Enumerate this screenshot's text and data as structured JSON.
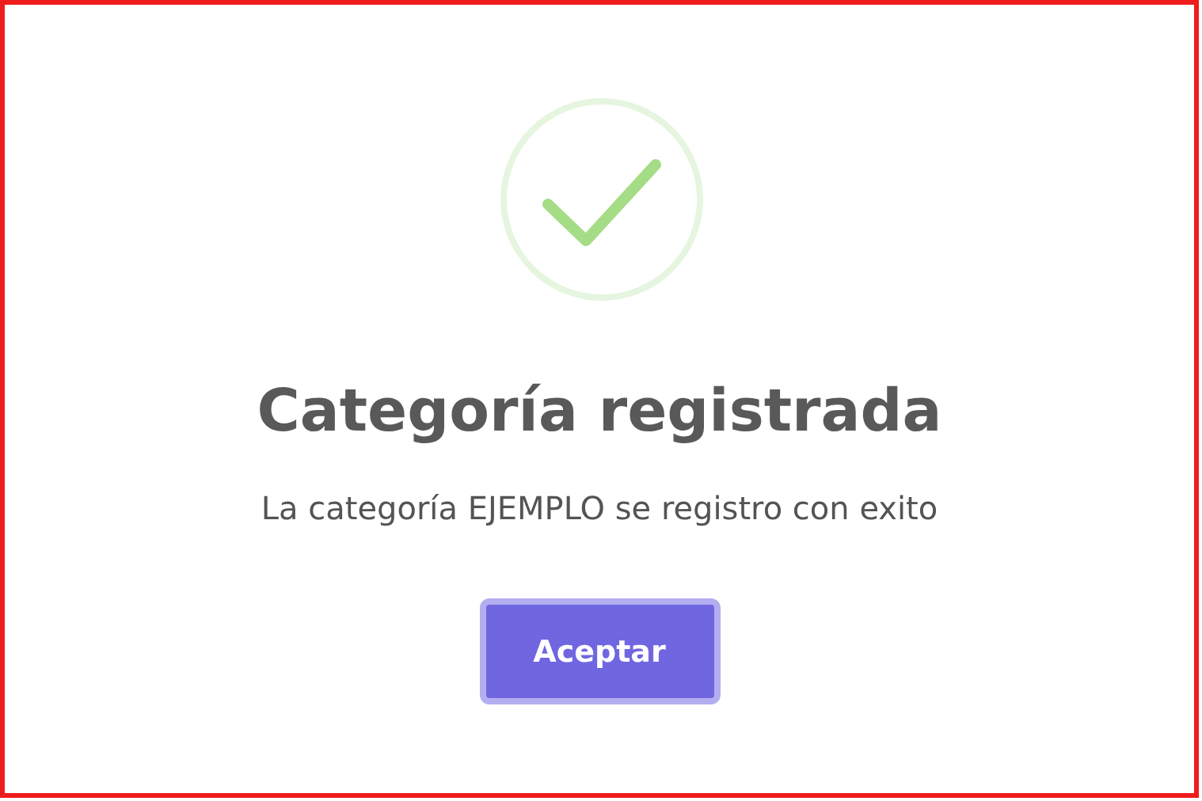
{
  "dialog": {
    "icon": {
      "kind": "success"
    },
    "title": "Categoría registrada",
    "message": "La categoría EJEMPLO se registro con exito",
    "buttons": [
      {
        "label": "Aceptar",
        "focused": true
      }
    ]
  }
}
